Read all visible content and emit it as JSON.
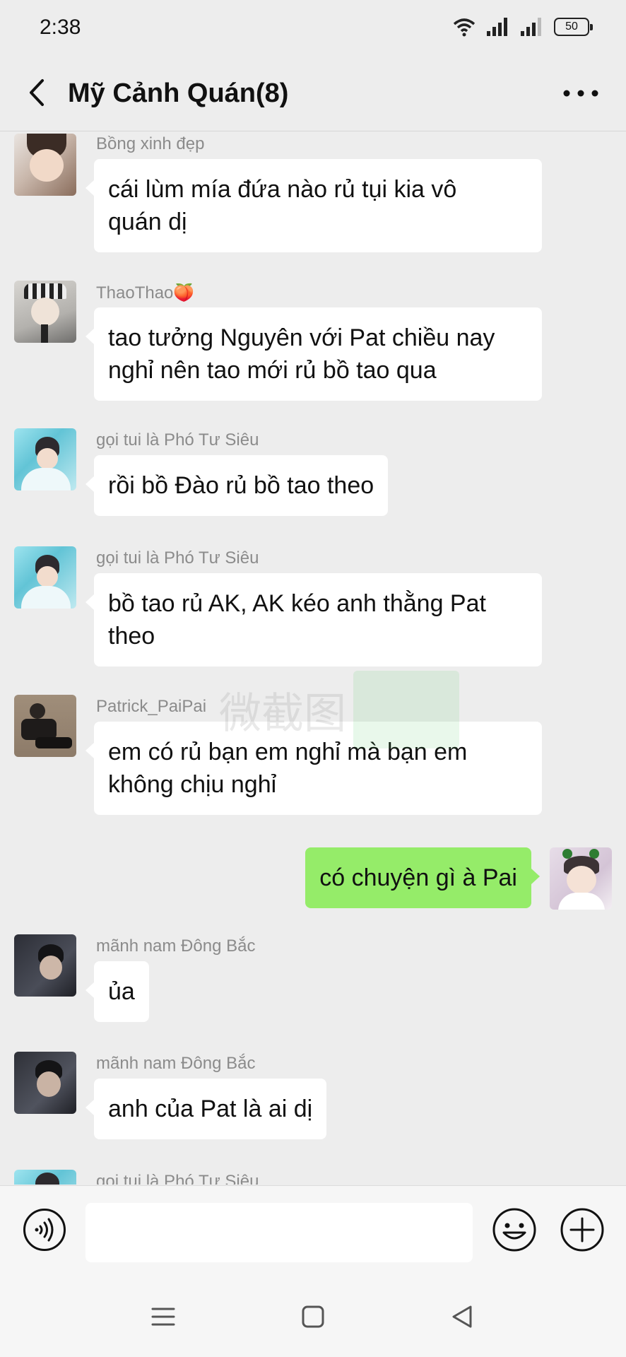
{
  "status_bar": {
    "time": "2:38",
    "battery": "50",
    "icons": [
      "wifi-icon",
      "signal-icon",
      "signal-icon-2",
      "battery-icon"
    ]
  },
  "header": {
    "title": "Mỹ Cảnh Quán(8)",
    "back_icon": "chevron-left-icon",
    "more_icon": "more-dots-icon"
  },
  "messages": [
    {
      "sender": "Bồng xinh đẹp",
      "text": "cái lùm mía đứa nào rủ tụi kia vô\nquán dị",
      "from_me": false
    },
    {
      "sender": "ThaoThao🍑",
      "text": "tao tưởng Nguyên với Pat chiều nay\nnghỉ nên tao mới rủ bồ tao qua",
      "from_me": false
    },
    {
      "sender": "gọi tui là Phó Tư Siêu",
      "text": "rồi bồ Đào rủ bồ tao theo",
      "from_me": false
    },
    {
      "sender": "gọi tui là Phó Tư Siêu",
      "text": "bồ tao rủ AK, AK kéo anh thằng Pat\ntheo",
      "from_me": false
    },
    {
      "sender": "Patrick_PaiPai",
      "text": "em có rủ bạn em nghỉ mà bạn em\nkhông chịu nghỉ",
      "from_me": false
    },
    {
      "sender": "",
      "text": "có chuyện gì à Pai",
      "from_me": true
    },
    {
      "sender": "mãnh nam Đông Bắc",
      "text": "ủa",
      "from_me": false
    },
    {
      "sender": "mãnh nam Đông Bắc",
      "text": "anh của Pat là ai dị",
      "from_me": false
    },
    {
      "sender": "gọi tui là Phó Tư Siêu",
      "text": "",
      "from_me": false
    }
  ],
  "watermark": {
    "text": "微截图"
  },
  "input_bar": {
    "value": "",
    "voice_icon": "voice-icon",
    "emoji_icon": "emoji-icon",
    "plus_icon": "plus-icon"
  },
  "nav_bar": {
    "icons": [
      "menu-icon",
      "home-square-icon",
      "back-triangle-icon"
    ]
  }
}
